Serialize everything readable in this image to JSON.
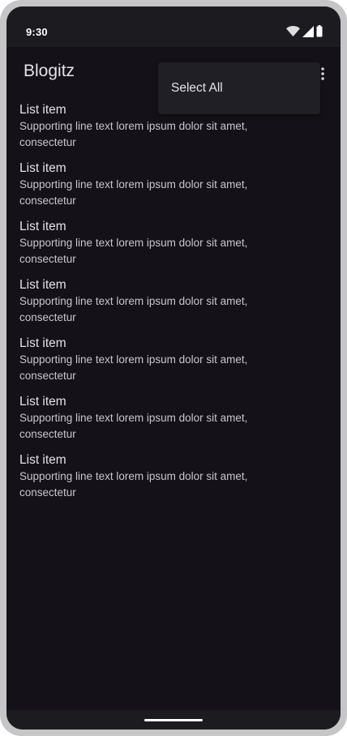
{
  "status_bar": {
    "time": "9:30",
    "icons": [
      "wifi-icon",
      "signal-icon",
      "battery-icon"
    ]
  },
  "app_bar": {
    "title": "Blogitz",
    "overflow_icon": "more-vert-icon"
  },
  "overflow_menu": {
    "items": [
      {
        "label": "Select All"
      }
    ]
  },
  "list": {
    "items": [
      {
        "headline": "List item",
        "supporting": "Supporting line text lorem ipsum dolor sit amet, consectetur"
      },
      {
        "headline": "List item",
        "supporting": "Supporting line text lorem ipsum dolor sit amet, consectetur"
      },
      {
        "headline": "List item",
        "supporting": "Supporting line text lorem ipsum dolor sit amet, consectetur"
      },
      {
        "headline": "List item",
        "supporting": "Supporting line text lorem ipsum dolor sit amet, consectetur"
      },
      {
        "headline": "List item",
        "supporting": "Supporting line text lorem ipsum dolor sit amet, consectetur"
      },
      {
        "headline": "List item",
        "supporting": "Supporting line text lorem ipsum dolor sit amet, consectetur"
      },
      {
        "headline": "List item",
        "supporting": "Supporting line text lorem ipsum dolor sit amet, consectetur"
      }
    ]
  },
  "colors": {
    "background": "#141218",
    "bar": "#1c1b20",
    "menu": "#211f26",
    "text_primary": "#e6e1e9",
    "text_secondary": "#cac4d0",
    "frame": "#c6c6c6"
  }
}
